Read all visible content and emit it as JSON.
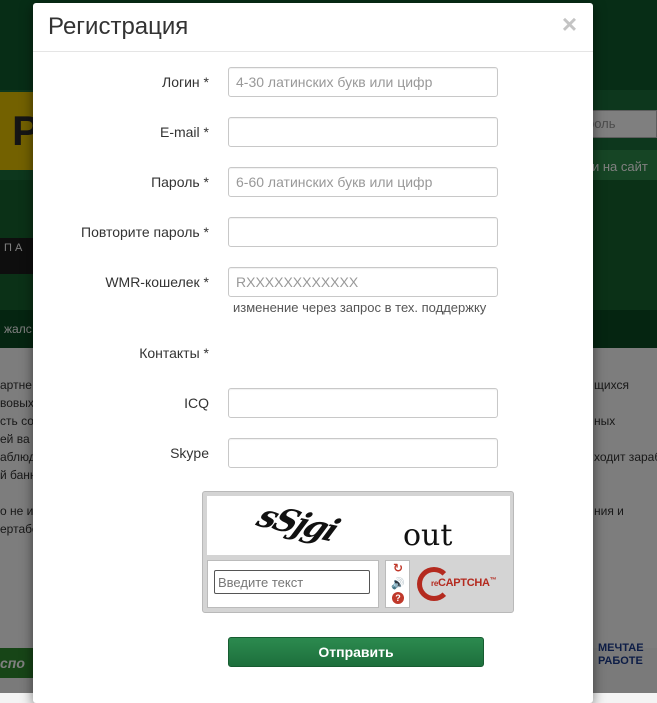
{
  "modal": {
    "title": "Регистрация",
    "close_symbol": "×"
  },
  "form": {
    "login": {
      "label": "Логин *",
      "placeholder": "4-30 латинских букв или цифр",
      "value": ""
    },
    "email": {
      "label": "E-mail *",
      "placeholder": "",
      "value": ""
    },
    "password": {
      "label": "Пароль *",
      "placeholder": "6-60 латинских букв или цифр",
      "value": ""
    },
    "password_repeat": {
      "label": "Повторите пароль *",
      "placeholder": "",
      "value": ""
    },
    "wmr": {
      "label": "WMR-кошелек *",
      "placeholder": "RXXXXXXXXXXXX",
      "hint": "изменение через запрос в тех. поддержку",
      "value": ""
    },
    "contacts": {
      "label": "Контакты *"
    },
    "icq": {
      "label": "ICQ",
      "placeholder": "",
      "value": ""
    },
    "skype": {
      "label": "Skype",
      "placeholder": "",
      "value": ""
    }
  },
  "captcha": {
    "word1": "sSjgi",
    "word2": "out",
    "input_placeholder": "Введите текст",
    "logo_re": "re",
    "logo_captcha": "CAPTCHA",
    "logo_tm": "™",
    "icons": [
      "refresh-icon",
      "audio-icon",
      "help-icon"
    ]
  },
  "submit_label": "Отправить",
  "background": {
    "logo_letter": "P",
    "search_placeholder": "роль",
    "login_button": "ти на сайт",
    "app_text": "П А",
    "nav_text": "жалс",
    "left_text": [
      "артне",
      "вовых с",
      "сть со",
      "ей ва",
      "аблюд",
      "й банн",
      "",
      "о не ин",
      "ертабе"
    ],
    "right_text": [
      "щихся",
      "",
      "ных",
      "",
      "ходит зараб",
      "",
      "",
      "ния и",
      ""
    ],
    "bottom_left": "спо",
    "bottom_right_1": "МЕЧТАЕ",
    "bottom_right_2": "РАБОТЕ"
  },
  "colors": {
    "header_green": "#0f5a2c",
    "submit_green": "#1d6f3c",
    "recaptcha_red": "#b42a1f"
  }
}
